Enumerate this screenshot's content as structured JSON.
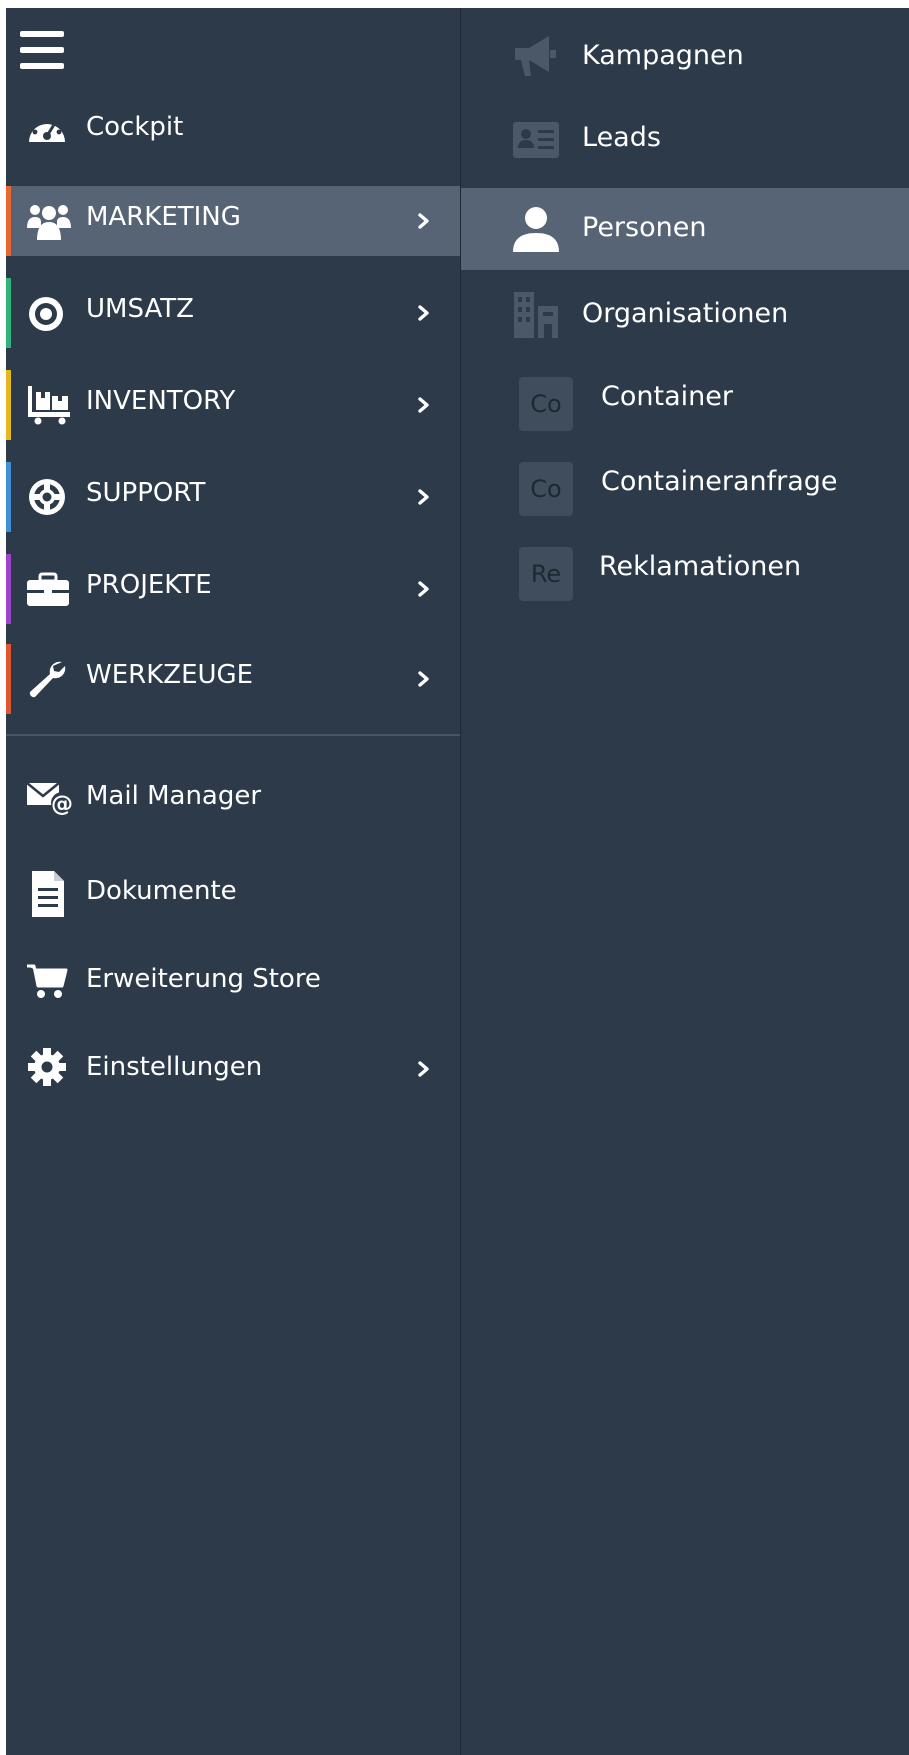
{
  "sidebar": {
    "menu_icon": "hamburger-menu-icon",
    "items": [
      {
        "label": "Cockpit",
        "icon": "dashboard-icon"
      },
      {
        "label": "MARKETING",
        "icon": "users-icon",
        "accent": "#e8692f",
        "active": true
      },
      {
        "label": "UMSATZ",
        "icon": "target-icon",
        "accent": "#2fb37a"
      },
      {
        "label": "INVENTORY",
        "icon": "warehouse-cart-icon",
        "accent": "#e6b61f"
      },
      {
        "label": "SUPPORT",
        "icon": "lifebuoy-icon",
        "accent": "#3f8fd6"
      },
      {
        "label": "PROJEKTE",
        "icon": "briefcase-icon",
        "accent": "#9b46c8"
      },
      {
        "label": "WERKZEUGE",
        "icon": "wrench-icon",
        "accent": "#e0562f"
      }
    ],
    "tools": [
      {
        "label": "Mail Manager",
        "icon": "mail-at-icon"
      },
      {
        "label": "Dokumente",
        "icon": "document-icon"
      },
      {
        "label": "Erweiterung Store",
        "icon": "cart-icon"
      },
      {
        "label": "Einstellungen",
        "icon": "gear-icon"
      }
    ]
  },
  "submenu": {
    "items": [
      {
        "label": "Kampagnen",
        "icon": "megaphone-icon"
      },
      {
        "label": "Leads",
        "icon": "id-card-icon"
      },
      {
        "label": "Personen",
        "icon": "person-icon",
        "active": true
      },
      {
        "label": "Organisationen",
        "icon": "building-icon"
      },
      {
        "label": "Container",
        "badge": "Co"
      },
      {
        "label": "Containeranfrage",
        "badge": "Co"
      },
      {
        "label": "Reklamationen",
        "badge": "Re"
      }
    ]
  },
  "colors": {
    "background": "#2d3a4a",
    "active_row": "#566475",
    "text": "#ffffff",
    "muted_icon": "#4b5867"
  }
}
